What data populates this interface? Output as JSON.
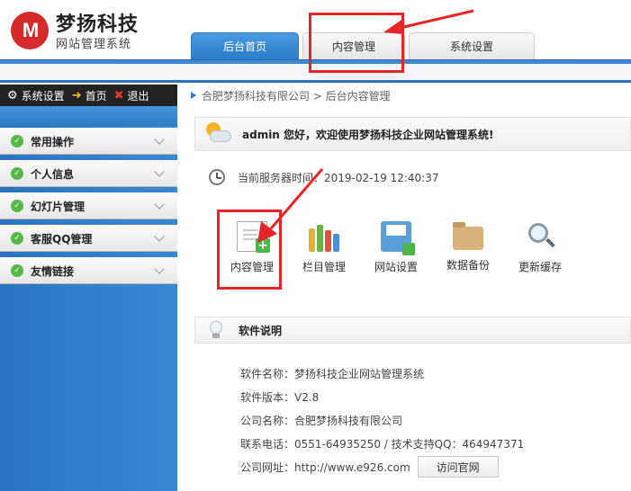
{
  "brand": {
    "logo_text": "M",
    "title": "梦扬科技",
    "subtitle": "网站管理系统"
  },
  "tabs": [
    {
      "label": "后台首页",
      "active": true
    },
    {
      "label": "内容管理",
      "active": false
    },
    {
      "label": "系统设置",
      "active": false
    }
  ],
  "toolbar": {
    "settings_label": "系统设置",
    "home_label": "首页",
    "exit_label": "退出"
  },
  "breadcrumb": "合肥梦扬科技有限公司 > 后台内容管理",
  "sidebar": {
    "items": [
      {
        "label": "常用操作"
      },
      {
        "label": "个人信息"
      },
      {
        "label": "幻灯片管理"
      },
      {
        "label": "客服QQ管理"
      },
      {
        "label": "友情链接"
      }
    ]
  },
  "welcome": {
    "text": "admin 您好，欢迎使用梦扬科技企业网站管理系统!"
  },
  "server_time": {
    "text": "当前服务器时间：2019-02-19 12:40:37"
  },
  "quick_actions": [
    {
      "label": "内容管理",
      "icon": "document-add-icon"
    },
    {
      "label": "栏目管理",
      "icon": "books-icon"
    },
    {
      "label": "网站设置",
      "icon": "floppy-icon"
    },
    {
      "label": "数据备份",
      "icon": "folder-icon"
    },
    {
      "label": "更新缓存",
      "icon": "magnifier-icon"
    }
  ],
  "software_info": {
    "title": "软件说明",
    "rows": [
      "软件名称：梦扬科技企业网站管理系统",
      "软件版本：V2.8",
      "公司名称：合肥梦扬科技有限公司",
      "联系电话：0551-64935250 / 技术支持QQ：464947371",
      "公司网址：http://www.e926.com"
    ],
    "visit_button": "访问官网"
  },
  "colors": {
    "accent_blue": "#2d7cc7",
    "annotation_red": "#e5252a",
    "logo_red": "#d42a2a",
    "check_green": "#55b849"
  }
}
